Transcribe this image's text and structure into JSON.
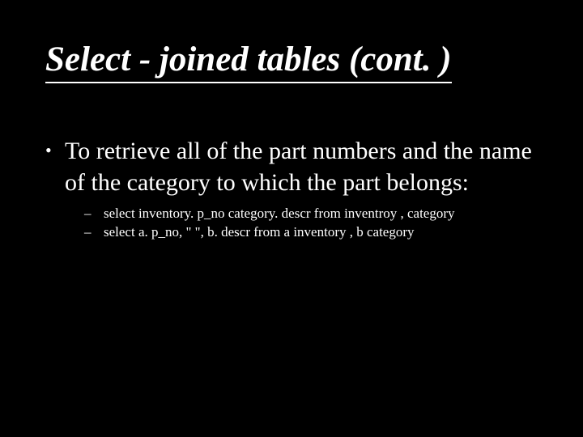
{
  "title": "Select - joined tables (cont. )",
  "bullets": {
    "point1": "To retrieve all of the part numbers and the name of the category to which the part belongs:",
    "sub1": "select  inventory. p_no category. descr  from  inventroy ,  category",
    "sub2": "select a. p_no, \"  \", b. descr  from a inventory , b category"
  },
  "glyphs": {
    "dot": "•",
    "dash": "–"
  }
}
